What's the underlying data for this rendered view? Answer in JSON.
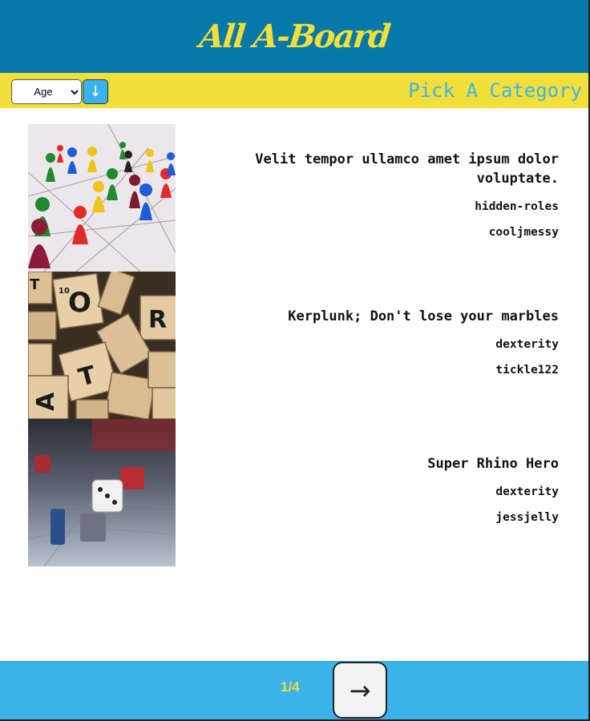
{
  "header": {
    "brand": "All A-Board"
  },
  "toolbar": {
    "sort_value": "Age",
    "sort_button_icon": "↓",
    "category_label": "Pick A Category"
  },
  "games": [
    {
      "title": "Velit tempor ullamco amet ipsum dolor voluptate.",
      "category": "hidden-roles",
      "author": "cooljmessy",
      "image": "pawns-network-photo"
    },
    {
      "title": "Kerplunk; Don't lose your marbles",
      "category": "dexterity",
      "author": "tickle122",
      "image": "scrabble-tiles-photo"
    },
    {
      "title": "Super Rhino Hero",
      "category": "dexterity",
      "author": "jessjelly",
      "image": "dice-board-photo"
    }
  ],
  "footer": {
    "page_indicator": "1/4",
    "next_icon": "→"
  },
  "colors": {
    "header_bg": "#0779a8",
    "accent_yellow": "#f3df3a",
    "accent_blue": "#3bb3ea"
  }
}
